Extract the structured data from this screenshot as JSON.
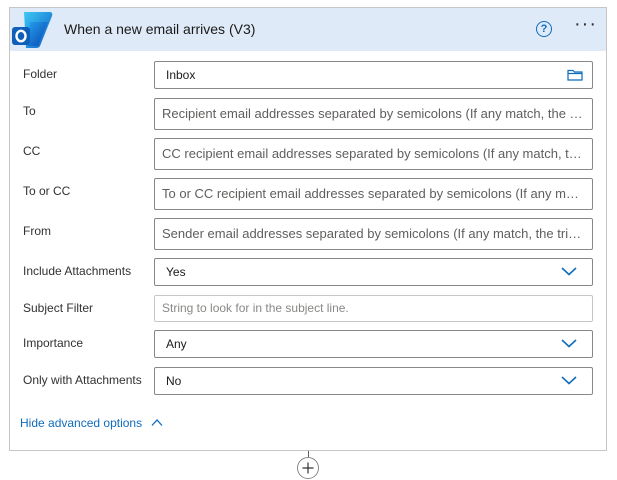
{
  "header": {
    "title": "When a new email arrives (V3)",
    "help_glyph": "?",
    "more_glyph": "···",
    "icon": "outlook-icon",
    "bg_color": "#dfeaf8"
  },
  "fields": {
    "folder": {
      "label": "Folder",
      "value": "Inbox",
      "icon": "folder-icon"
    },
    "to": {
      "label": "To",
      "placeholder": "Recipient email addresses separated by semicolons (If any match, the trigger will run)"
    },
    "cc": {
      "label": "CC",
      "placeholder": "CC recipient email addresses separated by semicolons (If any match, the trigger will run)"
    },
    "to_or_cc": {
      "label": "To or CC",
      "placeholder": "To or CC recipient email addresses separated by semicolons (If any match, the trigger will run)"
    },
    "from": {
      "label": "From",
      "placeholder": "Sender email addresses separated by semicolons (If any match, the trigger will run)"
    },
    "include_attachments": {
      "label": "Include Attachments",
      "value": "Yes"
    },
    "subject_filter": {
      "label": "Subject Filter",
      "placeholder": "String to look for in the subject line."
    },
    "importance": {
      "label": "Importance",
      "value": "Any"
    },
    "only_with_attachments": {
      "label": "Only with Attachments",
      "value": "No"
    }
  },
  "footer": {
    "hide_advanced_label": "Hide advanced options"
  },
  "colors": {
    "accent": "#0f6cbd",
    "border": "#8a8886"
  }
}
